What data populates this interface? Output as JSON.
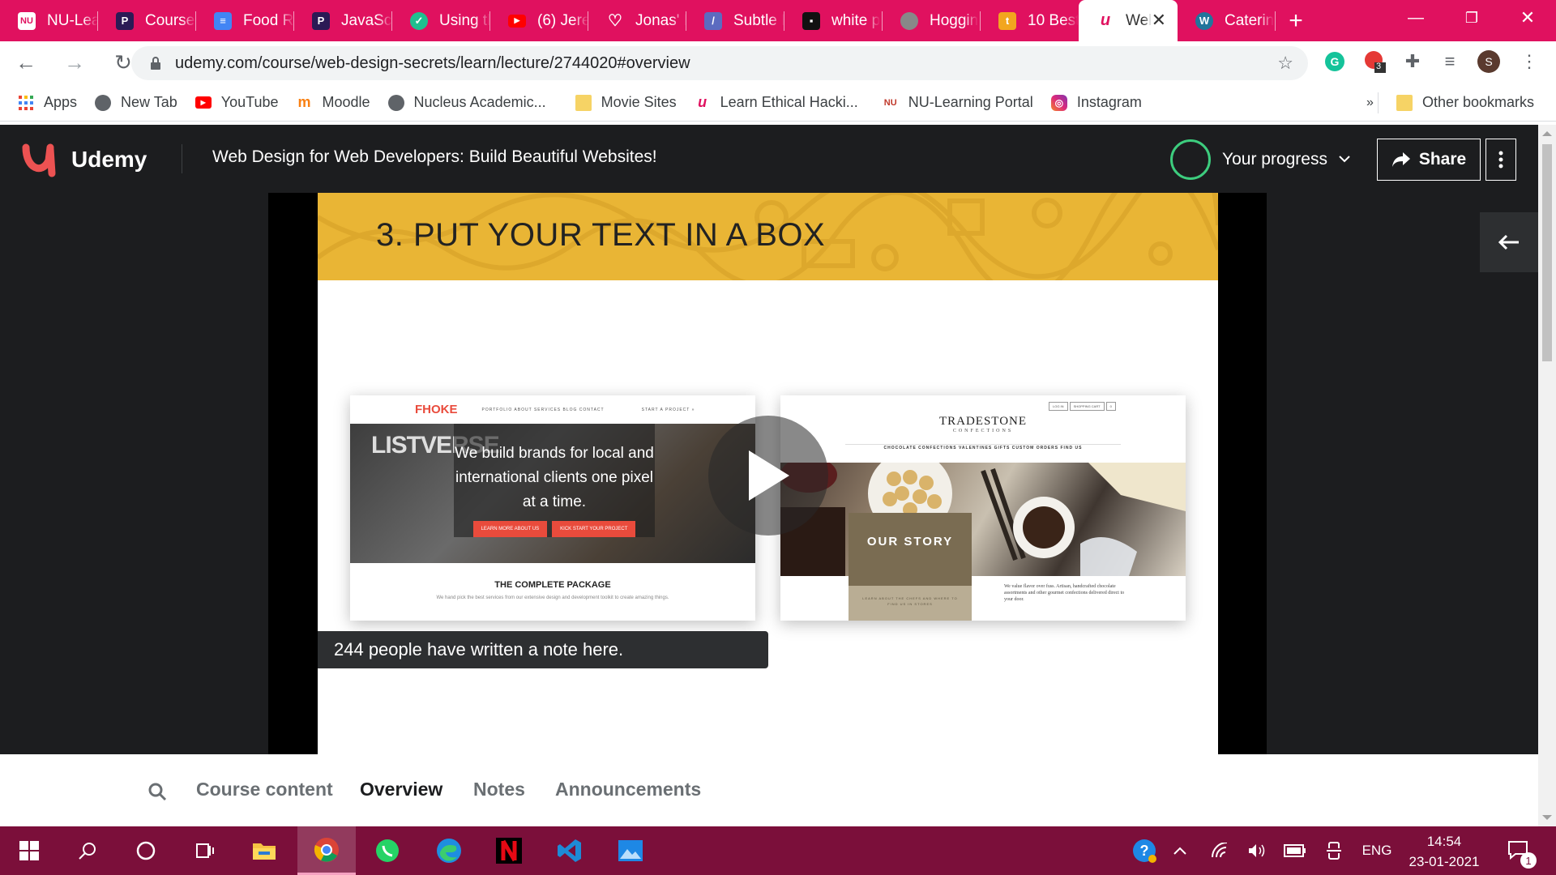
{
  "browser": {
    "tabs": [
      {
        "title": "NU-Lea",
        "icon": "nu-icon",
        "color": "#ffffff"
      },
      {
        "title": "Courses",
        "icon": "p-icon",
        "color": "#2b1a55"
      },
      {
        "title": "Food Re",
        "icon": "docs-icon",
        "color": "#4285f4"
      },
      {
        "title": "JavaScri",
        "icon": "p-icon",
        "color": "#2b1a55"
      },
      {
        "title": "Using tl",
        "icon": "shield-icon",
        "color": "#1fbf8f"
      },
      {
        "title": "(6) Jerer",
        "icon": "youtube-icon",
        "color": "#ff0000"
      },
      {
        "title": "Jonas' F",
        "icon": "heart-icon",
        "color": "#e0115f"
      },
      {
        "title": "Subtle F",
        "icon": "subtle-icon",
        "color": "#5c6bc0"
      },
      {
        "title": "white p",
        "icon": "unsplash-icon",
        "color": "#111111"
      },
      {
        "title": "Hoggin",
        "icon": "globe-icon",
        "color": "#888888"
      },
      {
        "title": "10 Best",
        "icon": "t-icon",
        "color": "#f2a61f"
      },
      {
        "title": "Wel",
        "icon": "udemy-icon",
        "color": "#ffffff",
        "active": true
      },
      {
        "title": "Caterin",
        "icon": "wordpress-icon",
        "color": "#21759b"
      }
    ],
    "url": "udemy.com/course/web-design-secrets/learn/lecture/2744020#overview",
    "extension_badge": "3",
    "profile_initial": "S",
    "bookmarks": [
      {
        "label": "Apps",
        "icon": "apps-grid-icon"
      },
      {
        "label": "New Tab",
        "icon": "globe-icon"
      },
      {
        "label": "YouTube",
        "icon": "youtube-icon"
      },
      {
        "label": "Moodle",
        "icon": "moodle-icon"
      },
      {
        "label": "Nucleus Academic...",
        "icon": "globe-icon"
      },
      {
        "label": "Movie Sites",
        "icon": "folder-icon"
      },
      {
        "label": "Learn Ethical Hacki...",
        "icon": "udemy-icon"
      },
      {
        "label": "NU-Learning Portal",
        "icon": "nu-icon"
      },
      {
        "label": "Instagram",
        "icon": "instagram-icon"
      }
    ],
    "bookmarks_overflow": "»",
    "other_bookmarks": "Other bookmarks"
  },
  "udemy": {
    "logo_text": "Udemy",
    "course_title": "Web Design for Web Developers: Build Beautiful Websites!",
    "progress_label": "Your progress",
    "share_label": "Share",
    "accent": "#3dcd7e"
  },
  "slide": {
    "heading": "3. PUT YOUR TEXT IN A BOX",
    "banner_color": "#e9b535",
    "shot1": {
      "brand": "FHOKE",
      "nav": "PORTFOLIO   ABOUT   SERVICES   BLOG   CONTACT",
      "nav_cta": "START A PROJECT »",
      "bg_word": "LISTVERSE",
      "tagline": "We build brands for local and international clients one pixel at a time.",
      "btn1": "LEARN MORE ABOUT US",
      "btn2": "KICK START YOUR PROJECT",
      "package_title": "THE COMPLETE PACKAGE",
      "package_sub": "We hand pick the best services from our extensive design and development toolkit to create amazing things."
    },
    "shot2": {
      "top_links": [
        "LOG IN",
        "SHOPPING CART",
        "0"
      ],
      "brand": "TRADESTONE",
      "brand_sub": "CONFECTIONS",
      "menu": "CHOCOLATE   CONFECTIONS   VALENTINES   GIFTS   CUSTOM ORDERS   FIND US",
      "story": "OUR STORY",
      "story_sub": "LEARN ABOUT THE CHEFS AND WHERE TO FIND US IN STORES",
      "side_text": "We value flavor over fuss. Artisan, handcrafted chocolate assortments and other gourmet confections delivered direct to your door."
    },
    "notes_pill": "244 people have written a note here."
  },
  "course_tabs": {
    "items": [
      "Course content",
      "Overview",
      "Notes",
      "Announcements"
    ],
    "active": "Overview"
  },
  "taskbar": {
    "apps": [
      "windows-start-icon",
      "search-icon",
      "cortana-icon",
      "task-view-icon",
      "file-explorer-icon",
      "chrome-icon",
      "whatsapp-icon",
      "edge-icon",
      "netflix-icon",
      "vscode-icon",
      "photos-icon"
    ],
    "language": "ENG",
    "time": "14:54",
    "date": "23-01-2021",
    "notification_count": "1"
  }
}
